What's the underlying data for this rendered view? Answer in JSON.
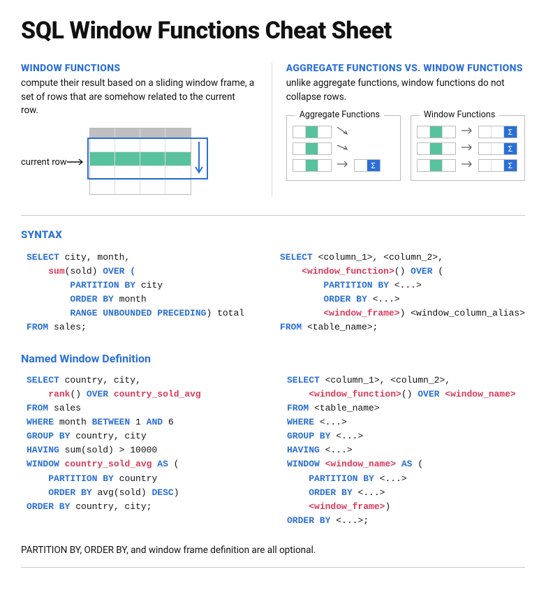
{
  "title": "SQL Window Functions Cheat Sheet",
  "left": {
    "heading": "WINDOW FUNCTIONS",
    "body": "compute their result based on a sliding window frame, a set of rows that are somehow related to the current row.",
    "current_row_label": "current row"
  },
  "right": {
    "heading": "AGGREGATE FUNCTIONS VS. WINDOW FUNCTIONS",
    "body": "unlike aggregate functions, window functions do not collapse rows.",
    "agg_label": "Aggregate Functions",
    "win_label": "Window Functions",
    "sigma": "Σ"
  },
  "syntax": {
    "heading": "SYNTAX",
    "named_heading": "Named Window Definition",
    "code1": {
      "l1a": "SELECT",
      "l1b": " city, month,",
      "l2a": "sum",
      "l2b": "(sold) ",
      "l2c": "OVER (",
      "l3": "PARTITION BY",
      "l3b": " city",
      "l4": "ORDER BY",
      "l4b": " month",
      "l5": "RANGE UNBOUNDED PRECEDING",
      "l5b": ") total",
      "l6a": "FROM",
      "l6b": " sales;"
    },
    "code2": {
      "l1a": "SELECT",
      "l1b": " <column_1>, <column_2>,",
      "l2a": "<window_function>",
      "l2b": "() ",
      "l2c": "OVER",
      "l2d": " (",
      "l3": "PARTITION BY",
      "l3b": " <...>",
      "l4": "ORDER BY",
      "l4b": " <...>",
      "l5": "<window_frame>",
      "l5b": ") <window_column_alias>",
      "l6a": "FROM",
      "l6b": " <table_name>;"
    },
    "code3": {
      "l1a": "SELECT",
      "l1b": " country, city,",
      "l2a": "rank",
      "l2b": "() ",
      "l2c": "OVER",
      "l2d": " ",
      "l2e": "country_sold_avg",
      "l3a": "FROM",
      "l3b": " sales",
      "l4a": "WHERE",
      "l4b": " month ",
      "l4c": "BETWEEN",
      "l4d": " 1 ",
      "l4e": "AND",
      "l4f": " 6",
      "l5a": "GROUP BY",
      "l5b": " country, city",
      "l6a": "HAVING",
      "l6b": " sum(sold) > 10000",
      "l7a": "WINDOW",
      "l7b": " ",
      "l7c": "country_sold_avg",
      "l7d": " ",
      "l7e": "AS",
      "l7f": " (",
      "l8a": "PARTITION BY",
      "l8b": " country",
      "l9a": "ORDER BY",
      "l9b": " avg(sold) ",
      "l9c": "DESC",
      "l9d": ")",
      "l10a": "ORDER BY",
      "l10b": " country, city;"
    },
    "code4": {
      "l1a": "SELECT",
      "l1b": " <column_1>, <column_2>,",
      "l2a": "<window_function>",
      "l2b": "() ",
      "l2c": "OVER",
      "l2d": " ",
      "l2e": "<window_name>",
      "l3a": "FROM",
      "l3b": " <table_name>",
      "l4a": "WHERE",
      "l4b": " <...>",
      "l5a": "GROUP BY",
      "l5b": " <...>",
      "l6a": "HAVING",
      "l6b": " <...>",
      "l7a": "WINDOW",
      "l7b": " ",
      "l7c": "<window_name>",
      "l7d": " ",
      "l7e": "AS",
      "l7f": " (",
      "l8a": "PARTITION BY",
      "l8b": " <...>",
      "l9a": "ORDER BY",
      "l9b": " <...>",
      "l10a": "<window_frame>",
      "l10b": ")",
      "l11a": "ORDER BY",
      "l11b": " <...>;"
    }
  },
  "footnote": {
    "lead": "PARTITION BY, ORDER BY,",
    "rest": "  and window frame definition are all optional."
  }
}
